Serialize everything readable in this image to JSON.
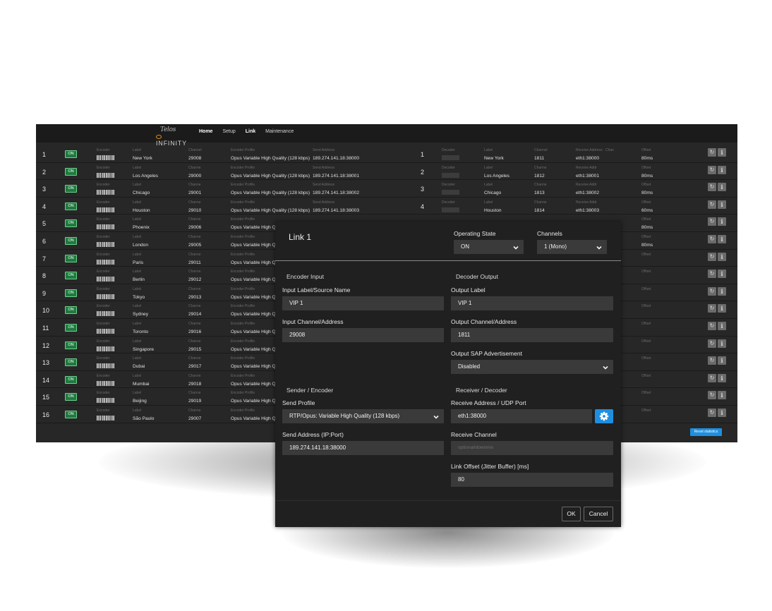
{
  "nav": {
    "logo_script": "Telos",
    "logo_word": "INFINITY",
    "items": [
      {
        "label": "Home",
        "active": true
      },
      {
        "label": "Setup",
        "active": false
      },
      {
        "label": "Link",
        "active": false
      },
      {
        "label": "Maintenance",
        "active": false
      }
    ]
  },
  "columns": {
    "encoder": "Encoder",
    "label": "Label",
    "channel_first": "Channel",
    "channel": "Channe",
    "encoder_profile": "Encoder Profile",
    "send_address": "Send Address",
    "decoder": "Decoder",
    "receive_address_first": "Receive Address · Chan",
    "receive_address": "Receive Addr",
    "offset": "Offset"
  },
  "on_label": "ON",
  "rows": [
    {
      "num": "1",
      "label": "New York",
      "channel": "29008",
      "profile": "Opus Variable High Quality (128 kbps)",
      "send": "189.274.141.18:38000",
      "dlabel": "New York",
      "dchannel": "1811",
      "recv": "eth1:38000",
      "offset": "80ms"
    },
    {
      "num": "2",
      "label": "Los Angeles",
      "channel": "29000",
      "profile": "Opus Variable High Quality (128 kbps)",
      "send": "189.274.141.18:38001",
      "dlabel": "Los Angeles",
      "dchannel": "1812",
      "recv": "eth1:38001",
      "offset": "80ms"
    },
    {
      "num": "3",
      "label": "Chicago",
      "channel": "29001",
      "profile": "Opus Variable High Quality (128 kbps)",
      "send": "189.274.141.18:38002",
      "dlabel": "Chicago",
      "dchannel": "1813",
      "recv": "eth1:38002",
      "offset": "80ms"
    },
    {
      "num": "4",
      "label": "Houston",
      "channel": "29010",
      "profile": "Opus Variable High Quality (128 kbps)",
      "send": "189.274.141.18:38003",
      "dlabel": "Houston",
      "dchannel": "1814",
      "recv": "eth1:38003",
      "offset": "60ms"
    },
    {
      "num": "5",
      "label": "Phoenix",
      "channel": "29006",
      "profile": "Opus Variable High Q",
      "offset": "80ms"
    },
    {
      "num": "6",
      "label": "London",
      "channel": "29005",
      "profile": "Opus Variable High Q",
      "offset": "80ms"
    },
    {
      "num": "7",
      "label": "Paris",
      "channel": "29011",
      "profile": "Opus Variable High Q"
    },
    {
      "num": "8",
      "label": "Berlin",
      "channel": "29012",
      "profile": "Opus Variable High Q"
    },
    {
      "num": "9",
      "label": "Tokyo",
      "channel": "29013",
      "profile": "Opus Variable High Q"
    },
    {
      "num": "10",
      "label": "Sydney",
      "channel": "29014",
      "profile": "Opus Variable High Q"
    },
    {
      "num": "11",
      "label": "Toronto",
      "channel": "29016",
      "profile": "Opus Variable High Q"
    },
    {
      "num": "12",
      "label": "Singapore",
      "channel": "29015",
      "profile": "Opus Variable High Q"
    },
    {
      "num": "13",
      "label": "Dubai",
      "channel": "29017",
      "profile": "Opus Variable High Q"
    },
    {
      "num": "14",
      "label": "Mumbai",
      "channel": "29018",
      "profile": "Opus Variable High Q"
    },
    {
      "num": "15",
      "label": "Beijing",
      "channel": "29019",
      "profile": "Opus Variable High Q"
    },
    {
      "num": "16",
      "label": "São Paulo",
      "channel": "29007",
      "profile": "Opus Variable High Q"
    }
  ],
  "reset_label": "Reset statistics",
  "modal": {
    "title": "Link 1",
    "operating_state_label": "Operating State",
    "operating_state_value": "ON",
    "channels_label": "Channels",
    "channels_value": "1 (Mono)",
    "encoder_input": "Encoder Input",
    "decoder_output": "Decoder Output",
    "input_label_label": "Input Label/Source Name",
    "input_label_value": "VIP 1",
    "output_label_label": "Output Label",
    "output_label_value": "VIP 1",
    "input_channel_label": "Input Channel/Address",
    "input_channel_value": "29008",
    "output_channel_label": "Output Channel/Address",
    "output_channel_value": "1811",
    "sap_label": "Output SAP Advertisement",
    "sap_value": "Disabled",
    "sender_encoder": "Sender / Encoder",
    "receiver_decoder": "Receiver / Decoder",
    "send_profile_label": "Send Profile",
    "send_profile_value": "RTP/Opus: Variable High Quality (128 kbps)",
    "receive_address_label": "Receive Address / UDP Port",
    "receive_address_value": "eth1:38000",
    "send_address_label": "Send Address (IP:Port)",
    "send_address_value": "189.274.141.18:38000",
    "receive_channel_label": "Receive Channel",
    "receive_channel_placeholder": "optional/downmix",
    "link_offset_label": "Link Offset (Jitter Buffer) [ms]",
    "link_offset_value": "80",
    "ok": "OK",
    "cancel": "Cancel"
  },
  "colors": {
    "accent": "#1e8fe0",
    "on_green": "#1f7a3f",
    "on_border": "#6fd18f",
    "panel": "#272727",
    "modal": "#202020"
  }
}
